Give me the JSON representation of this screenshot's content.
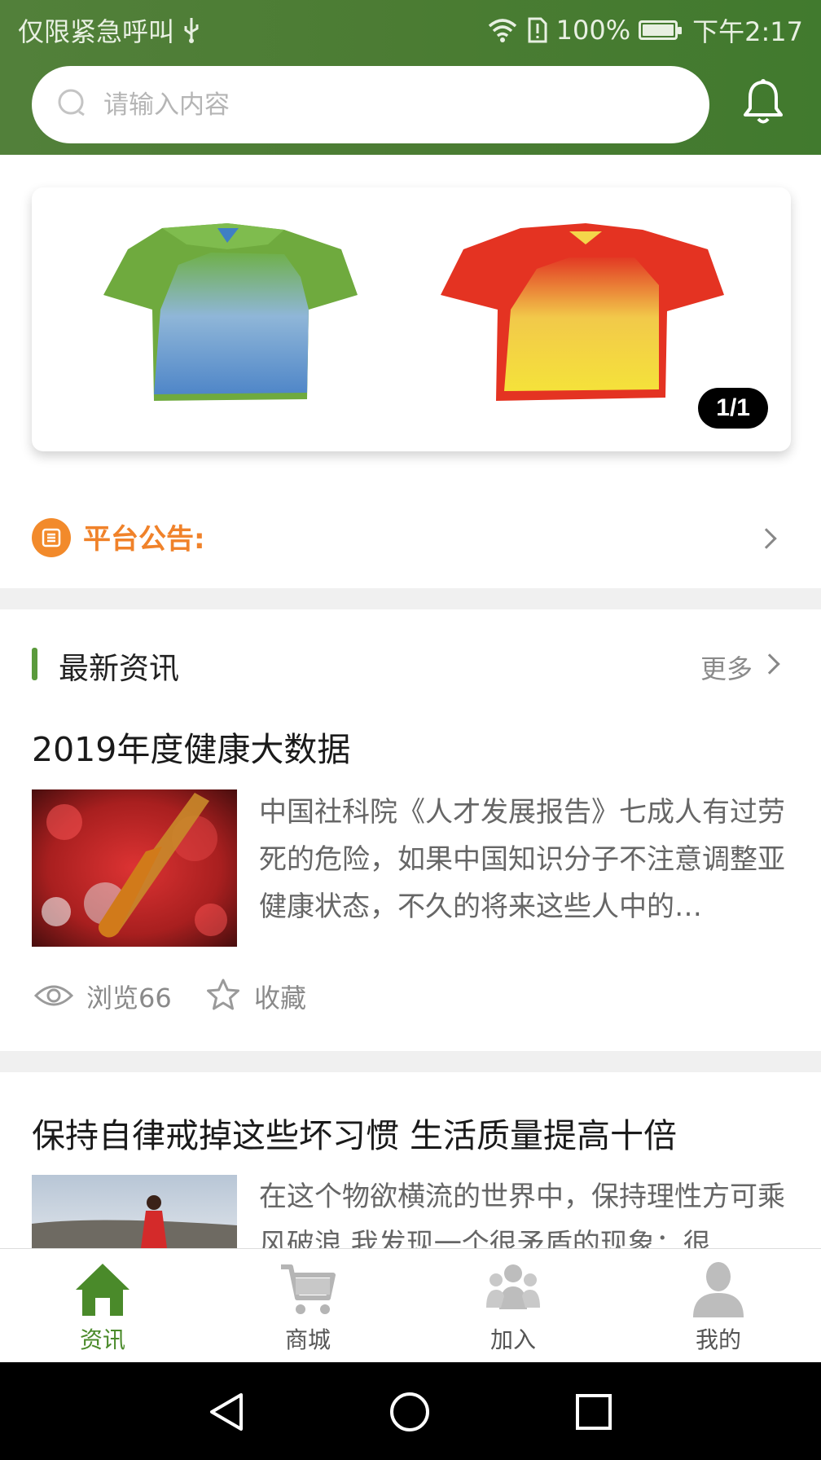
{
  "status_bar": {
    "carrier": "仅限紧急呼叫",
    "battery_percent": "100%",
    "time": "下午2:17",
    "battery_level": 1.0
  },
  "search": {
    "placeholder": "请输入内容",
    "value": ""
  },
  "banner": {
    "pager": "1/1"
  },
  "notice": {
    "label": "平台公告:"
  },
  "section": {
    "title": "最新资讯",
    "more": "更多"
  },
  "articles": [
    {
      "title": "2019年度健康大数据",
      "summary": "中国社科院《人才发展报告》七成人有过劳死的危险，如果中国知识分子不注意调整亚健康状态，不久的将来这些人中的…",
      "views": "浏览66",
      "favorite": "收藏"
    },
    {
      "title": "保持自律戒掉这些坏习惯 生活质量提高十倍",
      "summary": "在这个物欲横流的世界中，保持理性方可乘风破浪.我发现一个很矛盾的现象：很"
    }
  ],
  "tabs": [
    {
      "label": "资讯",
      "icon": "home-icon",
      "active": true
    },
    {
      "label": "商城",
      "icon": "cart-icon",
      "active": false
    },
    {
      "label": "加入",
      "icon": "group-icon",
      "active": false
    },
    {
      "label": "我的",
      "icon": "user-icon",
      "active": false
    }
  ],
  "colors": {
    "header_green": "#4b7c33",
    "accent_orange": "#f0822a",
    "active_tab": "#4a8a2a"
  }
}
